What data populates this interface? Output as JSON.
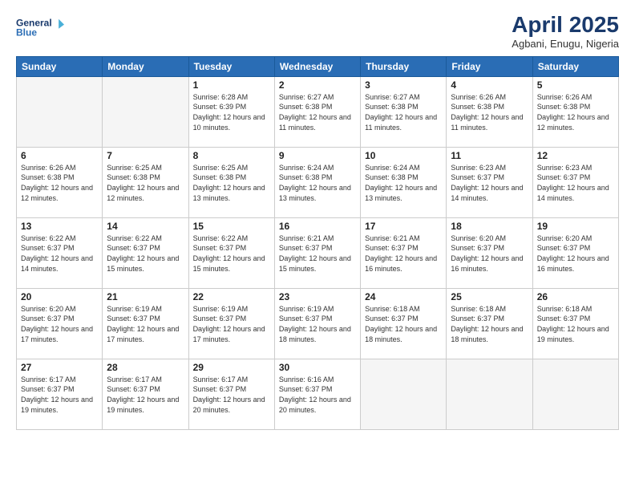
{
  "logo": {
    "line1": "General",
    "line2": "Blue"
  },
  "title": "April 2025",
  "subtitle": "Agbani, Enugu, Nigeria",
  "days": [
    "Sunday",
    "Monday",
    "Tuesday",
    "Wednesday",
    "Thursday",
    "Friday",
    "Saturday"
  ],
  "weeks": [
    [
      {
        "day": "",
        "text": ""
      },
      {
        "day": "",
        "text": ""
      },
      {
        "day": "1",
        "text": "Sunrise: 6:28 AM\nSunset: 6:39 PM\nDaylight: 12 hours and 10 minutes."
      },
      {
        "day": "2",
        "text": "Sunrise: 6:27 AM\nSunset: 6:38 PM\nDaylight: 12 hours and 11 minutes."
      },
      {
        "day": "3",
        "text": "Sunrise: 6:27 AM\nSunset: 6:38 PM\nDaylight: 12 hours and 11 minutes."
      },
      {
        "day": "4",
        "text": "Sunrise: 6:26 AM\nSunset: 6:38 PM\nDaylight: 12 hours and 11 minutes."
      },
      {
        "day": "5",
        "text": "Sunrise: 6:26 AM\nSunset: 6:38 PM\nDaylight: 12 hours and 12 minutes."
      }
    ],
    [
      {
        "day": "6",
        "text": "Sunrise: 6:26 AM\nSunset: 6:38 PM\nDaylight: 12 hours and 12 minutes."
      },
      {
        "day": "7",
        "text": "Sunrise: 6:25 AM\nSunset: 6:38 PM\nDaylight: 12 hours and 12 minutes."
      },
      {
        "day": "8",
        "text": "Sunrise: 6:25 AM\nSunset: 6:38 PM\nDaylight: 12 hours and 13 minutes."
      },
      {
        "day": "9",
        "text": "Sunrise: 6:24 AM\nSunset: 6:38 PM\nDaylight: 12 hours and 13 minutes."
      },
      {
        "day": "10",
        "text": "Sunrise: 6:24 AM\nSunset: 6:38 PM\nDaylight: 12 hours and 13 minutes."
      },
      {
        "day": "11",
        "text": "Sunrise: 6:23 AM\nSunset: 6:37 PM\nDaylight: 12 hours and 14 minutes."
      },
      {
        "day": "12",
        "text": "Sunrise: 6:23 AM\nSunset: 6:37 PM\nDaylight: 12 hours and 14 minutes."
      }
    ],
    [
      {
        "day": "13",
        "text": "Sunrise: 6:22 AM\nSunset: 6:37 PM\nDaylight: 12 hours and 14 minutes."
      },
      {
        "day": "14",
        "text": "Sunrise: 6:22 AM\nSunset: 6:37 PM\nDaylight: 12 hours and 15 minutes."
      },
      {
        "day": "15",
        "text": "Sunrise: 6:22 AM\nSunset: 6:37 PM\nDaylight: 12 hours and 15 minutes."
      },
      {
        "day": "16",
        "text": "Sunrise: 6:21 AM\nSunset: 6:37 PM\nDaylight: 12 hours and 15 minutes."
      },
      {
        "day": "17",
        "text": "Sunrise: 6:21 AM\nSunset: 6:37 PM\nDaylight: 12 hours and 16 minutes."
      },
      {
        "day": "18",
        "text": "Sunrise: 6:20 AM\nSunset: 6:37 PM\nDaylight: 12 hours and 16 minutes."
      },
      {
        "day": "19",
        "text": "Sunrise: 6:20 AM\nSunset: 6:37 PM\nDaylight: 12 hours and 16 minutes."
      }
    ],
    [
      {
        "day": "20",
        "text": "Sunrise: 6:20 AM\nSunset: 6:37 PM\nDaylight: 12 hours and 17 minutes."
      },
      {
        "day": "21",
        "text": "Sunrise: 6:19 AM\nSunset: 6:37 PM\nDaylight: 12 hours and 17 minutes."
      },
      {
        "day": "22",
        "text": "Sunrise: 6:19 AM\nSunset: 6:37 PM\nDaylight: 12 hours and 17 minutes."
      },
      {
        "day": "23",
        "text": "Sunrise: 6:19 AM\nSunset: 6:37 PM\nDaylight: 12 hours and 18 minutes."
      },
      {
        "day": "24",
        "text": "Sunrise: 6:18 AM\nSunset: 6:37 PM\nDaylight: 12 hours and 18 minutes."
      },
      {
        "day": "25",
        "text": "Sunrise: 6:18 AM\nSunset: 6:37 PM\nDaylight: 12 hours and 18 minutes."
      },
      {
        "day": "26",
        "text": "Sunrise: 6:18 AM\nSunset: 6:37 PM\nDaylight: 12 hours and 19 minutes."
      }
    ],
    [
      {
        "day": "27",
        "text": "Sunrise: 6:17 AM\nSunset: 6:37 PM\nDaylight: 12 hours and 19 minutes."
      },
      {
        "day": "28",
        "text": "Sunrise: 6:17 AM\nSunset: 6:37 PM\nDaylight: 12 hours and 19 minutes."
      },
      {
        "day": "29",
        "text": "Sunrise: 6:17 AM\nSunset: 6:37 PM\nDaylight: 12 hours and 20 minutes."
      },
      {
        "day": "30",
        "text": "Sunrise: 6:16 AM\nSunset: 6:37 PM\nDaylight: 12 hours and 20 minutes."
      },
      {
        "day": "",
        "text": ""
      },
      {
        "day": "",
        "text": ""
      },
      {
        "day": "",
        "text": ""
      }
    ]
  ]
}
